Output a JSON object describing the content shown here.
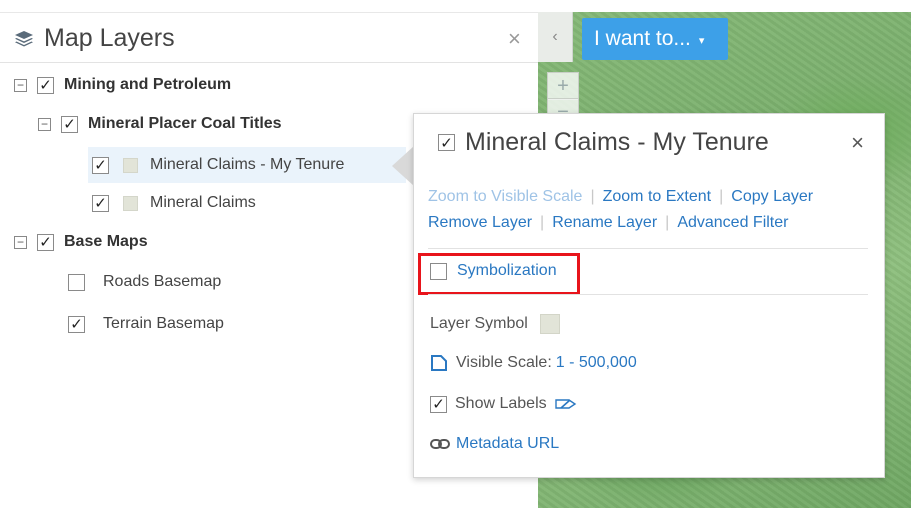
{
  "panel": {
    "title": "Map Layers",
    "close": "×"
  },
  "map": {
    "collapse": "‹",
    "want_button": "I want to...",
    "want_caret": "▾",
    "zoom_in": "+",
    "zoom_out": "−"
  },
  "tree": {
    "expander": "−",
    "check": "✓",
    "mining": "Mining and Petroleum",
    "mineral_placer": "Mineral Placer Coal Titles",
    "claims_tenure": "Mineral Claims - My Tenure",
    "claims": "Mineral Claims",
    "base_maps": "Base Maps",
    "roads": "Roads Basemap",
    "terrain": "Terrain Basemap"
  },
  "popup": {
    "title": "Mineral Claims - My Tenure",
    "close": "×",
    "actions": {
      "zoom_visible": "Zoom to Visible Scale",
      "zoom_extent": "Zoom to Extent",
      "copy_layer": "Copy Layer",
      "remove_layer": "Remove Layer",
      "rename_layer": "Rename Layer",
      "advanced_filter": "Advanced Filter",
      "separator": "|"
    },
    "symbolization": "Symbolization",
    "layer_symbol": "Layer Symbol",
    "visible_scale_label": "Visible Scale:",
    "visible_scale_value": "1 - 500,000",
    "show_labels": "Show Labels",
    "metadata": "Metadata URL"
  },
  "colors": {
    "accent": "#3da0e8",
    "link": "#2a78c2",
    "highlight": "#e8141b"
  }
}
